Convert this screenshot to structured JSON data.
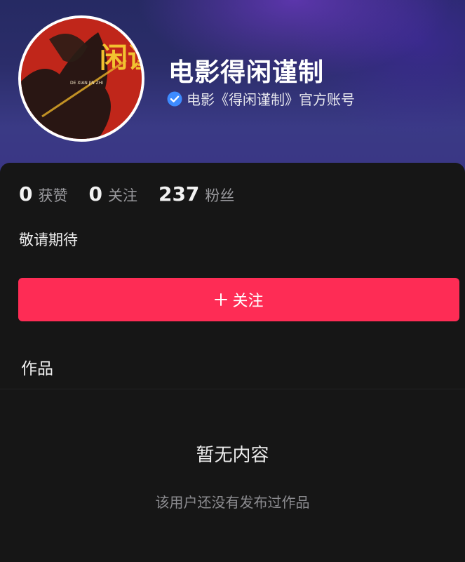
{
  "profile": {
    "name": "电影得闲谨制",
    "verified_text": "电影《得闲谨制》官方账号",
    "avatar_poster_text": "闲谨",
    "avatar_poster_subtext": "DE XIAN JIN ZHI"
  },
  "stats": [
    {
      "count": "0",
      "label": "获赞"
    },
    {
      "count": "0",
      "label": "关注"
    },
    {
      "count": "237",
      "label": "粉丝"
    }
  ],
  "bio": "敬请期待",
  "follow_button": {
    "label": "关注"
  },
  "tabs": {
    "works": "作品"
  },
  "empty_state": {
    "title": "暂无内容",
    "subtitle": "该用户还没有发布过作品"
  },
  "colors": {
    "accent": "#fe2c55",
    "verified": "#3d8bff",
    "background": "#161616"
  },
  "icons": {
    "verified": "verified-check-icon",
    "follow": "plus-icon"
  }
}
